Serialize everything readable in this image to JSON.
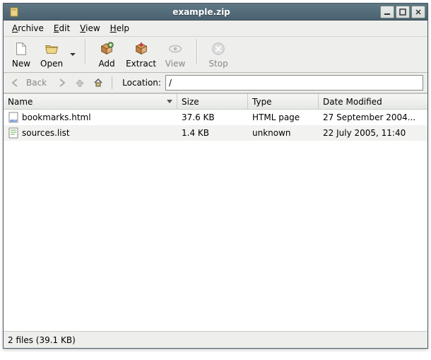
{
  "window": {
    "title": "example.zip"
  },
  "menu": {
    "archive": "Archive",
    "edit": "Edit",
    "view": "View",
    "help": "Help"
  },
  "toolbar": {
    "new": "New",
    "open": "Open",
    "add": "Add",
    "extract": "Extract",
    "view": "View",
    "stop": "Stop"
  },
  "location": {
    "back": "Back",
    "label": "Location:",
    "value": "/"
  },
  "columns": {
    "name": "Name",
    "size": "Size",
    "type": "Type",
    "date": "Date Modified"
  },
  "files": [
    {
      "name": "bookmarks.html",
      "size": "37.6 KB",
      "type": "HTML page",
      "date": "27 September 2004..."
    },
    {
      "name": "sources.list",
      "size": "1.4 KB",
      "type": "unknown",
      "date": "22 July 2005, 11:40"
    }
  ],
  "status": "2 files (39.1 KB)"
}
